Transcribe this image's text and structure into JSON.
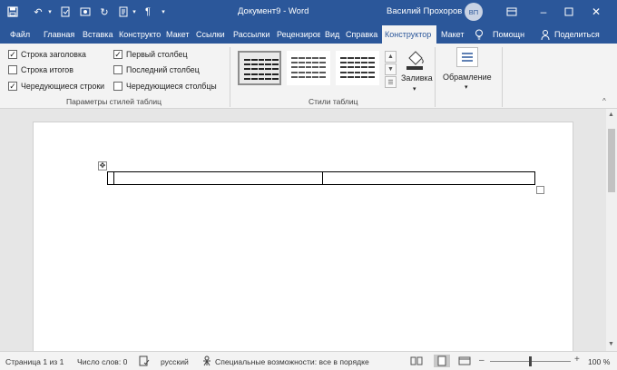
{
  "window": {
    "title": "Документ9  -  Word",
    "user_name": "Василий Прохоров",
    "avatar_initials": "ВП",
    "accent_color": "#2b579a"
  },
  "quick_access": {
    "icons": [
      "save-icon",
      "undo-icon",
      "redo-icon",
      "check-icon",
      "camera-icon",
      "autosave-icon",
      "format-icon",
      "paragraph-icon",
      "customize-icon"
    ]
  },
  "tabs": [
    {
      "label": "Файл"
    },
    {
      "label": "Главная"
    },
    {
      "label": "Вставка"
    },
    {
      "label": "Конструктор"
    },
    {
      "label": "Макет"
    },
    {
      "label": "Ссылки"
    },
    {
      "label": "Рассылки"
    },
    {
      "label": "Рецензирование"
    },
    {
      "label": "Вид"
    },
    {
      "label": "Справка"
    },
    {
      "label": "Конструктор"
    },
    {
      "label": "Макет"
    },
    {
      "label": "Помощн"
    },
    {
      "label": "Поделиться"
    }
  ],
  "table_style_options": {
    "group_label": "Параметры стилей таблиц",
    "items": [
      {
        "label": "Строка заголовка",
        "checked": true
      },
      {
        "label": "Строка итогов",
        "checked": false
      },
      {
        "label": "Чередующиеся строки",
        "checked": true
      },
      {
        "label": "Первый столбец",
        "checked": true
      },
      {
        "label": "Последний столбец",
        "checked": false
      },
      {
        "label": "Чередующиеся столбцы",
        "checked": false
      }
    ]
  },
  "table_styles": {
    "group_label": "Стили таблиц",
    "shading_label": "Заливка"
  },
  "borders": {
    "label": "Обрамление"
  },
  "status_bar": {
    "page": "Страница 1 из 1",
    "words": "Число слов: 0",
    "language": "русский",
    "accessibility": "Специальные возможности: все в порядке",
    "zoom": "100 %",
    "zoom_level_percent": 100
  }
}
